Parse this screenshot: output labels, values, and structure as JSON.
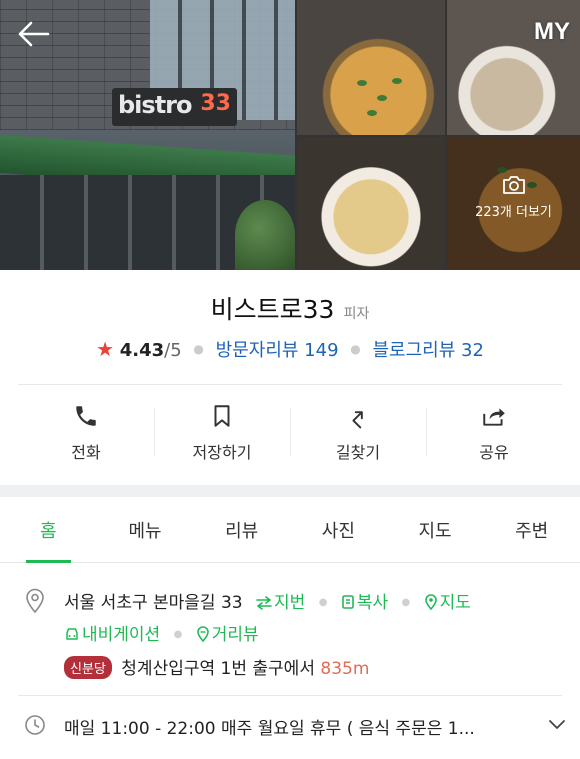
{
  "header": {
    "back_icon": "arrow-left-icon",
    "my_label": "MY",
    "more_photos_label": "223개 더보기",
    "storefront_sign": "bistro",
    "storefront_sign_num": "33"
  },
  "place": {
    "name": "비스트로33",
    "category": "피자",
    "rating": "4.43",
    "rating_scale": "/5",
    "visitor_reviews": "방문자리뷰 149",
    "blog_reviews": "블로그리뷰 32"
  },
  "actions": [
    {
      "label": "전화",
      "icon": "phone-icon"
    },
    {
      "label": "저장하기",
      "icon": "bookmark-icon"
    },
    {
      "label": "길찾기",
      "icon": "directions-icon"
    },
    {
      "label": "공유",
      "icon": "share-icon"
    }
  ],
  "tabs": [
    {
      "label": "홈",
      "active": true
    },
    {
      "label": "메뉴"
    },
    {
      "label": "리뷰"
    },
    {
      "label": "사진"
    },
    {
      "label": "지도"
    },
    {
      "label": "주변"
    }
  ],
  "info": {
    "address": "서울 서초구 본마을길 33",
    "jibun_label": "지번",
    "copy_label": "복사",
    "map_label": "지도",
    "navigation_label": "내비게이션",
    "street_view_label": "거리뷰",
    "station_badge": "신분당",
    "station_name": "청계산입구역",
    "exit_text": "1번 출구에서",
    "distance": "835m",
    "hours": "매일 11:00 - 22:00 매주 월요일 휴무 ( 음식 주문은 1..."
  },
  "colors": {
    "accent_green": "#1fb954",
    "link_blue": "#1f63b6",
    "star_red": "#e8423a",
    "line_badge": "#b3303a",
    "distance": "#e06c55"
  }
}
